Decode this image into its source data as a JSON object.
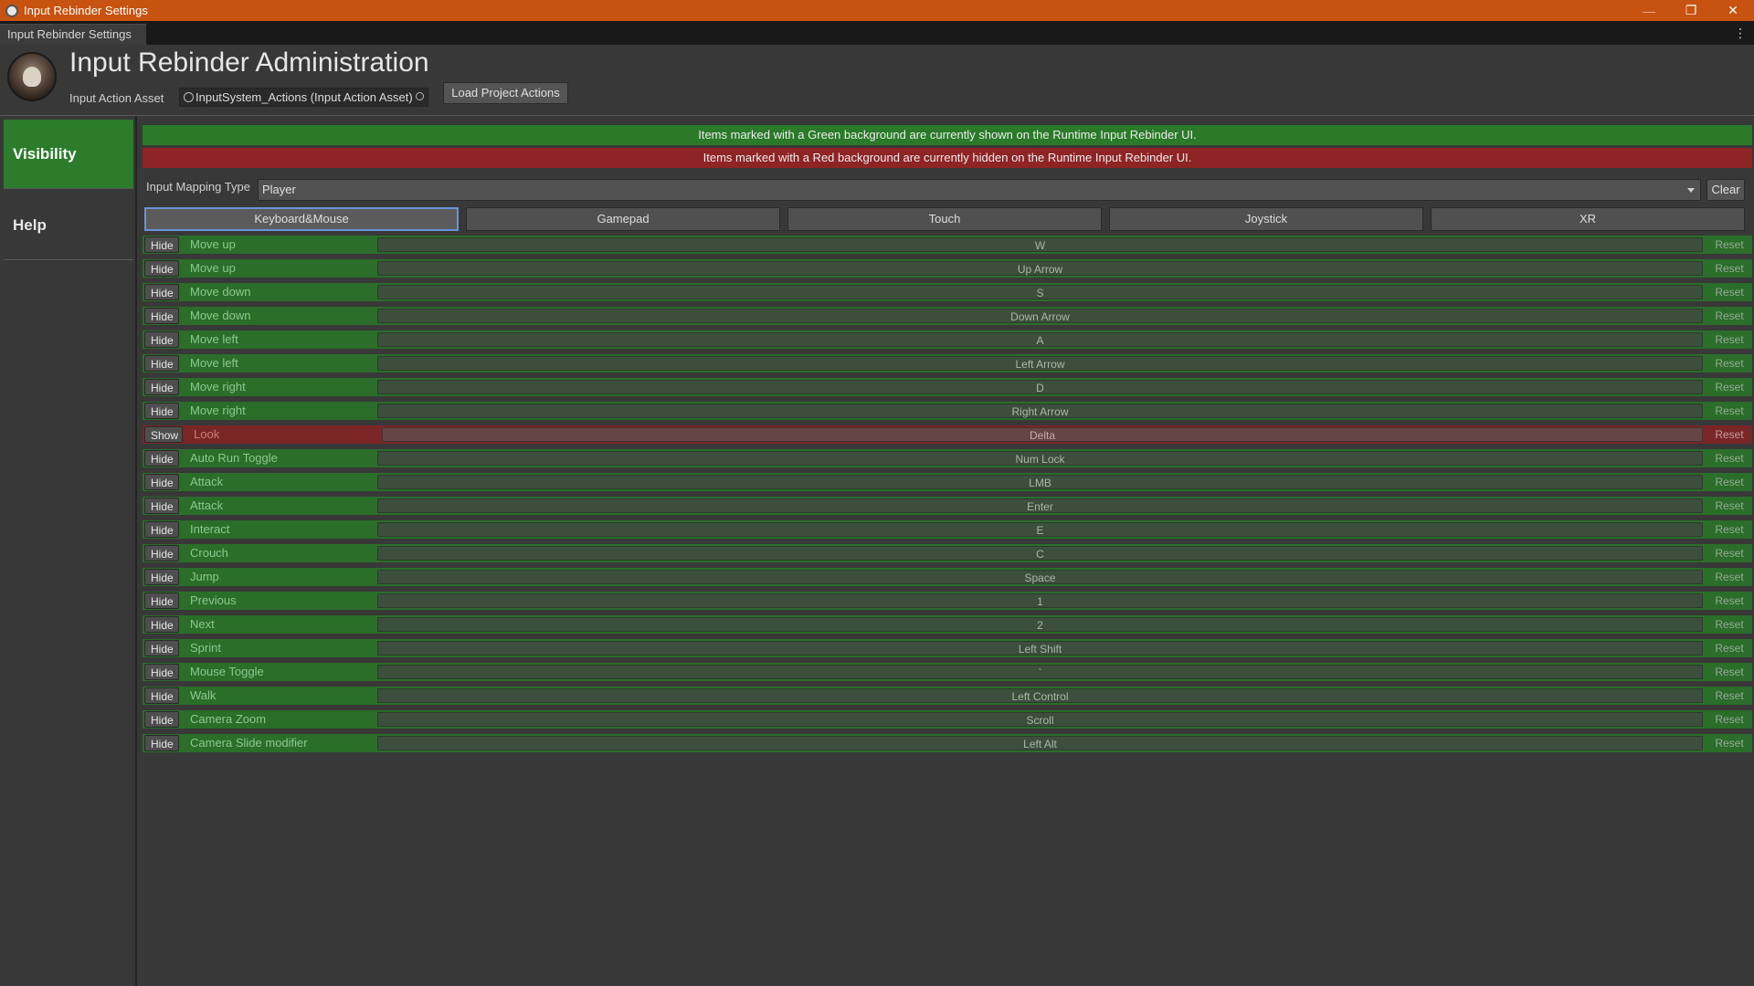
{
  "window": {
    "title": "Input Rebinder Settings",
    "tab_label": "Input Rebinder Settings",
    "controls": {
      "minimize": "—",
      "restore": "❐",
      "close": "✕"
    },
    "menu_glyph": "⋮"
  },
  "header": {
    "title": "Input Rebinder Administration",
    "asset_label": "Input Action Asset",
    "asset_value": "InputSystem_Actions (Input Action Asset)",
    "load_button": "Load Project Actions"
  },
  "sidebar": {
    "items": [
      {
        "label": "Visibility",
        "active": true
      },
      {
        "label": "Help",
        "active": false
      }
    ]
  },
  "banners": {
    "green": "Items marked with a Green background are currently shown on the Runtime Input Rebinder UI.",
    "red": "Items marked with a Red background are currently hidden on the Runtime Input Rebinder UI."
  },
  "mapping": {
    "label": "Input Mapping Type",
    "value": "Player",
    "clear_button": "Clear"
  },
  "device_tabs": [
    {
      "label": "Keyboard&Mouse",
      "active": true
    },
    {
      "label": "Gamepad",
      "active": false
    },
    {
      "label": "Touch",
      "active": false
    },
    {
      "label": "Joystick",
      "active": false
    },
    {
      "label": "XR",
      "active": false
    }
  ],
  "colors": {
    "shown": "#2a6e2a",
    "hidden": "#7a2626",
    "titlebar": "#c8520f",
    "active_sidebar": "#2c7c2c"
  },
  "bindings": [
    {
      "toggle": "Hide",
      "action": "Move up",
      "binding": "W",
      "reset": "Reset",
      "shown": true
    },
    {
      "toggle": "Hide",
      "action": "Move up",
      "binding": "Up Arrow",
      "reset": "Reset",
      "shown": true
    },
    {
      "toggle": "Hide",
      "action": "Move down",
      "binding": "S",
      "reset": "Reset",
      "shown": true
    },
    {
      "toggle": "Hide",
      "action": "Move down",
      "binding": "Down Arrow",
      "reset": "Reset",
      "shown": true
    },
    {
      "toggle": "Hide",
      "action": "Move left",
      "binding": "A",
      "reset": "Reset",
      "shown": true
    },
    {
      "toggle": "Hide",
      "action": "Move left",
      "binding": "Left Arrow",
      "reset": "Reset",
      "shown": true
    },
    {
      "toggle": "Hide",
      "action": "Move right",
      "binding": "D",
      "reset": "Reset",
      "shown": true
    },
    {
      "toggle": "Hide",
      "action": "Move right",
      "binding": "Right Arrow",
      "reset": "Reset",
      "shown": true
    },
    {
      "toggle": "Show",
      "action": "Look",
      "binding": "Delta",
      "reset": "Reset",
      "shown": false
    },
    {
      "toggle": "Hide",
      "action": "Auto Run Toggle",
      "binding": "Num Lock",
      "reset": "Reset",
      "shown": true
    },
    {
      "toggle": "Hide",
      "action": "Attack",
      "binding": "LMB",
      "reset": "Reset",
      "shown": true
    },
    {
      "toggle": "Hide",
      "action": "Attack",
      "binding": "Enter",
      "reset": "Reset",
      "shown": true
    },
    {
      "toggle": "Hide",
      "action": "Interact",
      "binding": "E",
      "reset": "Reset",
      "shown": true
    },
    {
      "toggle": "Hide",
      "action": "Crouch",
      "binding": "C",
      "reset": "Reset",
      "shown": true
    },
    {
      "toggle": "Hide",
      "action": "Jump",
      "binding": "Space",
      "reset": "Reset",
      "shown": true
    },
    {
      "toggle": "Hide",
      "action": "Previous",
      "binding": "1",
      "reset": "Reset",
      "shown": true
    },
    {
      "toggle": "Hide",
      "action": "Next",
      "binding": "2",
      "reset": "Reset",
      "shown": true
    },
    {
      "toggle": "Hide",
      "action": "Sprint",
      "binding": "Left Shift",
      "reset": "Reset",
      "shown": true
    },
    {
      "toggle": "Hide",
      "action": "Mouse Toggle",
      "binding": "`",
      "reset": "Reset",
      "shown": true
    },
    {
      "toggle": "Hide",
      "action": "Walk",
      "binding": "Left Control",
      "reset": "Reset",
      "shown": true
    },
    {
      "toggle": "Hide",
      "action": "Camera Zoom",
      "binding": "Scroll",
      "reset": "Reset",
      "shown": true
    },
    {
      "toggle": "Hide",
      "action": "Camera Slide modifier",
      "binding": "Left Alt",
      "reset": "Reset",
      "shown": true
    }
  ]
}
